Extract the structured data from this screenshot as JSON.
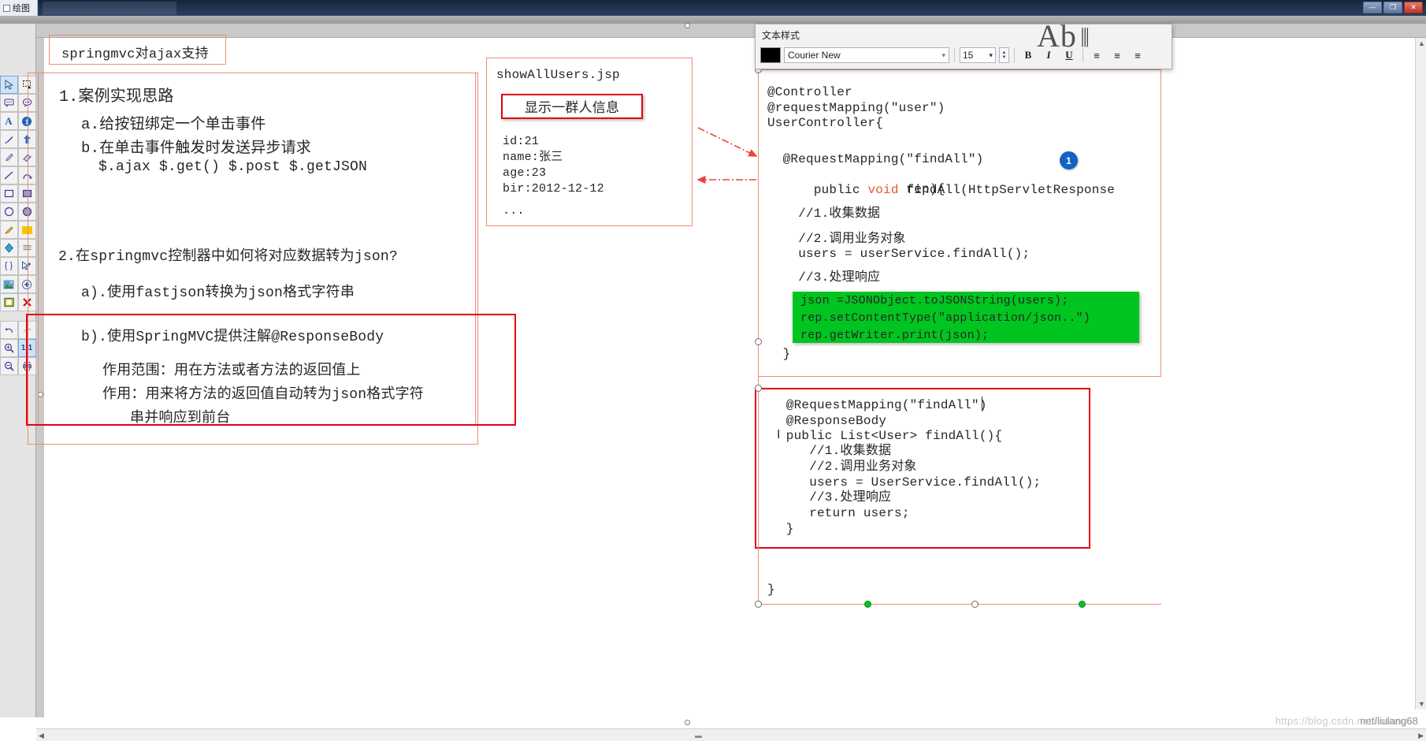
{
  "window": {
    "tab_label": "绘图",
    "minimize": "—",
    "maximize": "❐",
    "close": "✕"
  },
  "toolbar": {
    "tools": [
      {
        "name": "select-pointer-tool",
        "glyph": "➤",
        "selected": true
      },
      {
        "name": "marquee-select-tool",
        "glyph": "⬚",
        "selected": false
      },
      {
        "name": "callout-left-tool",
        "glyph": "💬",
        "selected": false
      },
      {
        "name": "callout-round-tool",
        "glyph": "💭",
        "selected": false
      },
      {
        "name": "text-tool",
        "glyph": "A",
        "selected": false
      },
      {
        "name": "numbered-badge-tool",
        "glyph": "①",
        "selected": false
      },
      {
        "name": "pen-tool",
        "glyph": "✎",
        "selected": false
      },
      {
        "name": "arrow-up-tool",
        "glyph": "⬆",
        "selected": false
      },
      {
        "name": "pencil-tool",
        "glyph": "✐",
        "selected": false
      },
      {
        "name": "eraser-tool",
        "glyph": "▱",
        "selected": false
      },
      {
        "name": "line-tool",
        "glyph": "╱",
        "selected": false
      },
      {
        "name": "curve-arrow-tool",
        "glyph": "⌒",
        "selected": false
      },
      {
        "name": "rectangle-outline-tool",
        "glyph": "▭",
        "selected": false
      },
      {
        "name": "rectangle-filled-tool",
        "glyph": "▣",
        "selected": false
      },
      {
        "name": "ellipse-outline-tool",
        "glyph": "◯",
        "selected": false
      },
      {
        "name": "ellipse-filled-tool",
        "glyph": "●",
        "selected": false
      },
      {
        "name": "highlighter-tool",
        "glyph": "🖊",
        "selected": false
      },
      {
        "name": "fill-color-tool",
        "glyph": "▮",
        "selected": false
      },
      {
        "name": "color-picker-tool",
        "glyph": "◆",
        "selected": false
      },
      {
        "name": "blur-tool",
        "glyph": "▤",
        "selected": false
      },
      {
        "name": "brace-tool",
        "glyph": "{}",
        "selected": false
      },
      {
        "name": "add-select-tool",
        "glyph": "➤⁺",
        "selected": false
      },
      {
        "name": "image-insert-tool",
        "glyph": "🖼",
        "selected": false
      },
      {
        "name": "add-node-tool",
        "glyph": "⊕",
        "selected": false
      },
      {
        "name": "border-tool",
        "glyph": "▥",
        "selected": false
      },
      {
        "name": "delete-tool",
        "glyph": "✕",
        "selected": false
      },
      {
        "name": "undo-tool",
        "glyph": "↶",
        "selected": false
      },
      {
        "name": "redo-tool",
        "glyph": "↷",
        "selected": false
      },
      {
        "name": "zoom-in-tool",
        "glyph": "🔍",
        "selected": false
      },
      {
        "name": "zoom-actual-size-tool",
        "glyph": "1:1",
        "selected": true
      },
      {
        "name": "zoom-out-tool",
        "glyph": "🔍",
        "selected": false
      },
      {
        "name": "print-tool",
        "glyph": "🖨",
        "selected": false
      }
    ]
  },
  "format_panel": {
    "title": "文本样式",
    "color_swatch": "#000000",
    "font_family": "Courier New",
    "font_size": "15",
    "bold": "B",
    "italic": "I",
    "underline": "U",
    "align_left": "≡",
    "align_center": "≡",
    "align_right": "≡",
    "dropdown_arrow": "▾",
    "spin_up": "▲",
    "spin_down": "▼"
  },
  "canvas": {
    "title_box": "springmvc对ajax支持",
    "section1": {
      "heading": "1.案例实现思路",
      "items": [
        "a.给按钮绑定一个单击事件",
        "b.在单击事件触发时发送异步请求",
        "  $.ajax $.get() $.post $.getJSON"
      ]
    },
    "section2": {
      "heading": "2.在springmvc控制器中如何将对应数据转为json?",
      "item_a": "a).使用fastjson转换为json格式字符串",
      "item_b": "b).使用SpringMVC提供注解@ResponseBody",
      "scope_line": "作用范围：用在方法或者方法的返回值上",
      "effect_line1": "作用：用来将方法的返回值自动转为json格式字符",
      "effect_line2": "串并响应到前台"
    },
    "jsp_box": {
      "title": "showAllUsers.jsp",
      "highlight": "显示一群人信息",
      "data_lines": [
        "id:21",
        "name:张三",
        "age:23",
        "bir:2012-12-12",
        "",
        "..."
      ]
    },
    "code_block_1": {
      "lines": [
        "@Controller",
        "@requestMapping(\"user\")",
        "UserController{",
        "",
        "  @RequestMapping(\"findAll\")",
        "  public void findAll(HttpServletResponse",
        "                  rep){",
        "",
        "    //1.收集数据",
        "",
        "    //2.调用业务对象",
        "    users = userService.findAll();",
        "",
        "    //3.处理响应"
      ],
      "keyword": "void",
      "badge": "1"
    },
    "green_highlight": {
      "color": "#00c520",
      "lines": [
        "json =JSONObject.toJSONString(users);",
        "rep.setContentType(\"application/json..\")",
        "rep.getWriter.print(json);"
      ]
    },
    "code_block_1_tail": "  }",
    "code_block_2": {
      "lines": [
        " @RequestMapping(\"findAll\")",
        " @ResponseBody",
        " public List<User> findAll(){",
        "    //1.收集数据",
        "    //2.调用业务对象",
        "    users = UserService.findAll();",
        "    //3.处理响应",
        "    return users;",
        " }"
      ]
    },
    "closing_brace": "}"
  },
  "watermark": {
    "left": "https://blog.csdn.net/liulang68",
    "right": "net/liulang68"
  }
}
